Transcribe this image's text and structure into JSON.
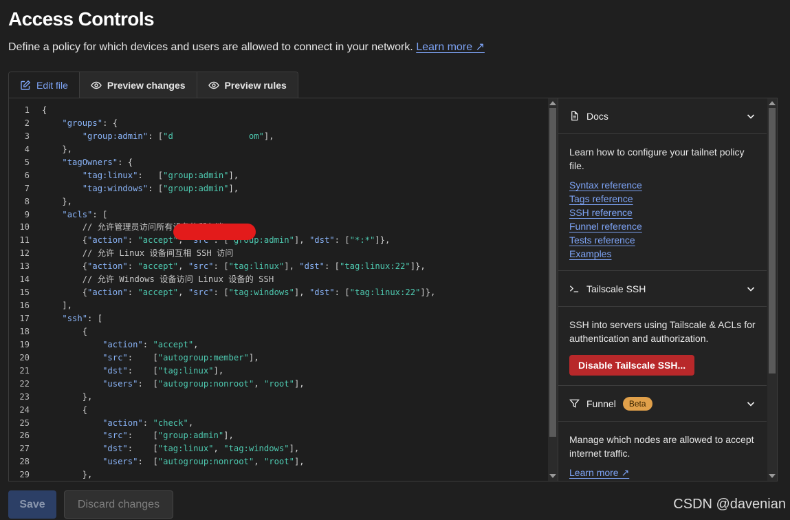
{
  "page": {
    "title": "Access Controls",
    "subtitle": "Define a policy for which devices and users are allowed to connect in your network.",
    "learn_more": "Learn more ↗"
  },
  "tabs": [
    {
      "label": "Edit file",
      "icon": "edit-icon",
      "active": true
    },
    {
      "label": "Preview changes",
      "icon": "eye-icon",
      "active": false
    },
    {
      "label": "Preview rules",
      "icon": "eye-icon",
      "active": false
    }
  ],
  "editor": {
    "lines": [
      {
        "n": "1",
        "segs": [
          {
            "t": "{",
            "c": "p"
          }
        ]
      },
      {
        "n": "2",
        "segs": [
          {
            "t": "    ",
            "c": "p"
          },
          {
            "t": "\"groups\"",
            "c": "k"
          },
          {
            "t": ": {",
            "c": "p"
          }
        ]
      },
      {
        "n": "3",
        "segs": [
          {
            "t": "        ",
            "c": "p"
          },
          {
            "t": "\"group:admin\"",
            "c": "k"
          },
          {
            "t": ": [",
            "c": "p"
          },
          {
            "t": "\"d",
            "c": "s"
          },
          {
            "t": "               ",
            "c": "p"
          },
          {
            "t": "om\"",
            "c": "s"
          },
          {
            "t": "],",
            "c": "p"
          }
        ]
      },
      {
        "n": "4",
        "segs": [
          {
            "t": "    },",
            "c": "p"
          }
        ]
      },
      {
        "n": "5",
        "segs": [
          {
            "t": "    ",
            "c": "p"
          },
          {
            "t": "\"tagOwners\"",
            "c": "k"
          },
          {
            "t": ": {",
            "c": "p"
          }
        ]
      },
      {
        "n": "6",
        "segs": [
          {
            "t": "        ",
            "c": "p"
          },
          {
            "t": "\"tag:linux\"",
            "c": "k"
          },
          {
            "t": ":   [",
            "c": "p"
          },
          {
            "t": "\"group:admin\"",
            "c": "s"
          },
          {
            "t": "],",
            "c": "p"
          }
        ]
      },
      {
        "n": "7",
        "segs": [
          {
            "t": "        ",
            "c": "p"
          },
          {
            "t": "\"tag:windows\"",
            "c": "k"
          },
          {
            "t": ": [",
            "c": "p"
          },
          {
            "t": "\"group:admin\"",
            "c": "s"
          },
          {
            "t": "],",
            "c": "p"
          }
        ]
      },
      {
        "n": "8",
        "segs": [
          {
            "t": "    },",
            "c": "p"
          }
        ]
      },
      {
        "n": "9",
        "segs": [
          {
            "t": "    ",
            "c": "p"
          },
          {
            "t": "\"acls\"",
            "c": "k"
          },
          {
            "t": ": [",
            "c": "p"
          }
        ]
      },
      {
        "n": "10",
        "segs": [
          {
            "t": "        ",
            "c": "p"
          },
          {
            "t": "// 允许管理员访问所有设备的所有端口",
            "c": "c"
          }
        ]
      },
      {
        "n": "11",
        "segs": [
          {
            "t": "        {",
            "c": "p"
          },
          {
            "t": "\"action\"",
            "c": "k"
          },
          {
            "t": ": ",
            "c": "p"
          },
          {
            "t": "\"accept\"",
            "c": "s"
          },
          {
            "t": ", ",
            "c": "p"
          },
          {
            "t": "\"src\"",
            "c": "k"
          },
          {
            "t": ": [",
            "c": "p"
          },
          {
            "t": "\"group:admin\"",
            "c": "s"
          },
          {
            "t": "], ",
            "c": "p"
          },
          {
            "t": "\"dst\"",
            "c": "k"
          },
          {
            "t": ": [",
            "c": "p"
          },
          {
            "t": "\"*:*\"",
            "c": "s"
          },
          {
            "t": "]},",
            "c": "p"
          }
        ]
      },
      {
        "n": "12",
        "segs": [
          {
            "t": "        ",
            "c": "p"
          },
          {
            "t": "// 允许 Linux 设备间互相 SSH 访问",
            "c": "c"
          }
        ]
      },
      {
        "n": "13",
        "segs": [
          {
            "t": "        {",
            "c": "p"
          },
          {
            "t": "\"action\"",
            "c": "k"
          },
          {
            "t": ": ",
            "c": "p"
          },
          {
            "t": "\"accept\"",
            "c": "s"
          },
          {
            "t": ", ",
            "c": "p"
          },
          {
            "t": "\"src\"",
            "c": "k"
          },
          {
            "t": ": [",
            "c": "p"
          },
          {
            "t": "\"tag:linux\"",
            "c": "s"
          },
          {
            "t": "], ",
            "c": "p"
          },
          {
            "t": "\"dst\"",
            "c": "k"
          },
          {
            "t": ": [",
            "c": "p"
          },
          {
            "t": "\"tag:linux:22\"",
            "c": "s"
          },
          {
            "t": "]},",
            "c": "p"
          }
        ]
      },
      {
        "n": "14",
        "segs": [
          {
            "t": "        ",
            "c": "p"
          },
          {
            "t": "// 允许 Windows 设备访问 Linux 设备的 SSH",
            "c": "c"
          }
        ]
      },
      {
        "n": "15",
        "segs": [
          {
            "t": "        {",
            "c": "p"
          },
          {
            "t": "\"action\"",
            "c": "k"
          },
          {
            "t": ": ",
            "c": "p"
          },
          {
            "t": "\"accept\"",
            "c": "s"
          },
          {
            "t": ", ",
            "c": "p"
          },
          {
            "t": "\"src\"",
            "c": "k"
          },
          {
            "t": ": [",
            "c": "p"
          },
          {
            "t": "\"tag:windows\"",
            "c": "s"
          },
          {
            "t": "], ",
            "c": "p"
          },
          {
            "t": "\"dst\"",
            "c": "k"
          },
          {
            "t": ": [",
            "c": "p"
          },
          {
            "t": "\"tag:linux:22\"",
            "c": "s"
          },
          {
            "t": "]},",
            "c": "p"
          }
        ]
      },
      {
        "n": "16",
        "segs": [
          {
            "t": "    ],",
            "c": "p"
          }
        ]
      },
      {
        "n": "17",
        "segs": [
          {
            "t": "    ",
            "c": "p"
          },
          {
            "t": "\"ssh\"",
            "c": "k"
          },
          {
            "t": ": [",
            "c": "p"
          }
        ]
      },
      {
        "n": "18",
        "segs": [
          {
            "t": "        {",
            "c": "p"
          }
        ]
      },
      {
        "n": "19",
        "segs": [
          {
            "t": "            ",
            "c": "p"
          },
          {
            "t": "\"action\"",
            "c": "k"
          },
          {
            "t": ": ",
            "c": "p"
          },
          {
            "t": "\"accept\"",
            "c": "s"
          },
          {
            "t": ",",
            "c": "p"
          }
        ]
      },
      {
        "n": "20",
        "segs": [
          {
            "t": "            ",
            "c": "p"
          },
          {
            "t": "\"src\"",
            "c": "k"
          },
          {
            "t": ":    [",
            "c": "p"
          },
          {
            "t": "\"autogroup:member\"",
            "c": "s"
          },
          {
            "t": "],",
            "c": "p"
          }
        ]
      },
      {
        "n": "21",
        "segs": [
          {
            "t": "            ",
            "c": "p"
          },
          {
            "t": "\"dst\"",
            "c": "k"
          },
          {
            "t": ":    [",
            "c": "p"
          },
          {
            "t": "\"tag:linux\"",
            "c": "s"
          },
          {
            "t": "],",
            "c": "p"
          }
        ]
      },
      {
        "n": "22",
        "segs": [
          {
            "t": "            ",
            "c": "p"
          },
          {
            "t": "\"users\"",
            "c": "k"
          },
          {
            "t": ":  [",
            "c": "p"
          },
          {
            "t": "\"autogroup:nonroot\"",
            "c": "s"
          },
          {
            "t": ", ",
            "c": "p"
          },
          {
            "t": "\"root\"",
            "c": "s"
          },
          {
            "t": "],",
            "c": "p"
          }
        ]
      },
      {
        "n": "23",
        "segs": [
          {
            "t": "        },",
            "c": "p"
          }
        ]
      },
      {
        "n": "24",
        "segs": [
          {
            "t": "        {",
            "c": "p"
          }
        ]
      },
      {
        "n": "25",
        "segs": [
          {
            "t": "            ",
            "c": "p"
          },
          {
            "t": "\"action\"",
            "c": "k"
          },
          {
            "t": ": ",
            "c": "p"
          },
          {
            "t": "\"check\"",
            "c": "s"
          },
          {
            "t": ",",
            "c": "p"
          }
        ]
      },
      {
        "n": "26",
        "segs": [
          {
            "t": "            ",
            "c": "p"
          },
          {
            "t": "\"src\"",
            "c": "k"
          },
          {
            "t": ":    [",
            "c": "p"
          },
          {
            "t": "\"group:admin\"",
            "c": "s"
          },
          {
            "t": "],",
            "c": "p"
          }
        ]
      },
      {
        "n": "27",
        "segs": [
          {
            "t": "            ",
            "c": "p"
          },
          {
            "t": "\"dst\"",
            "c": "k"
          },
          {
            "t": ":    [",
            "c": "p"
          },
          {
            "t": "\"tag:linux\"",
            "c": "s"
          },
          {
            "t": ", ",
            "c": "p"
          },
          {
            "t": "\"tag:windows\"",
            "c": "s"
          },
          {
            "t": "],",
            "c": "p"
          }
        ]
      },
      {
        "n": "28",
        "segs": [
          {
            "t": "            ",
            "c": "p"
          },
          {
            "t": "\"users\"",
            "c": "k"
          },
          {
            "t": ":  [",
            "c": "p"
          },
          {
            "t": "\"autogroup:nonroot\"",
            "c": "s"
          },
          {
            "t": ", ",
            "c": "p"
          },
          {
            "t": "\"root\"",
            "c": "s"
          },
          {
            "t": "],",
            "c": "p"
          }
        ]
      },
      {
        "n": "29",
        "segs": [
          {
            "t": "        },",
            "c": "p"
          }
        ]
      }
    ]
  },
  "sidebar": {
    "docs": {
      "title": "Docs",
      "icon": "document-icon",
      "description": "Learn how to configure your tailnet policy file.",
      "links": [
        "Syntax reference",
        "Tags reference",
        "SSH reference",
        "Funnel reference",
        "Tests reference",
        "Examples"
      ]
    },
    "ssh": {
      "title": "Tailscale SSH",
      "icon": "terminal-icon",
      "description": "SSH into servers using Tailscale & ACLs for authentication and authorization.",
      "button": "Disable Tailscale SSH..."
    },
    "funnel": {
      "title": "Funnel",
      "icon": "filter-icon",
      "badge": "Beta",
      "description": "Manage which nodes are allowed to accept internet traffic.",
      "link": "Learn more ↗"
    }
  },
  "footer": {
    "save": "Save",
    "discard": "Discard changes"
  },
  "watermark": "CSDN @davenian",
  "colors": {
    "accent": "#7da3f5",
    "danger": "#b8282a",
    "badge": "#e0a04a",
    "key": "#8ab4f8",
    "string": "#4ec9b0"
  }
}
